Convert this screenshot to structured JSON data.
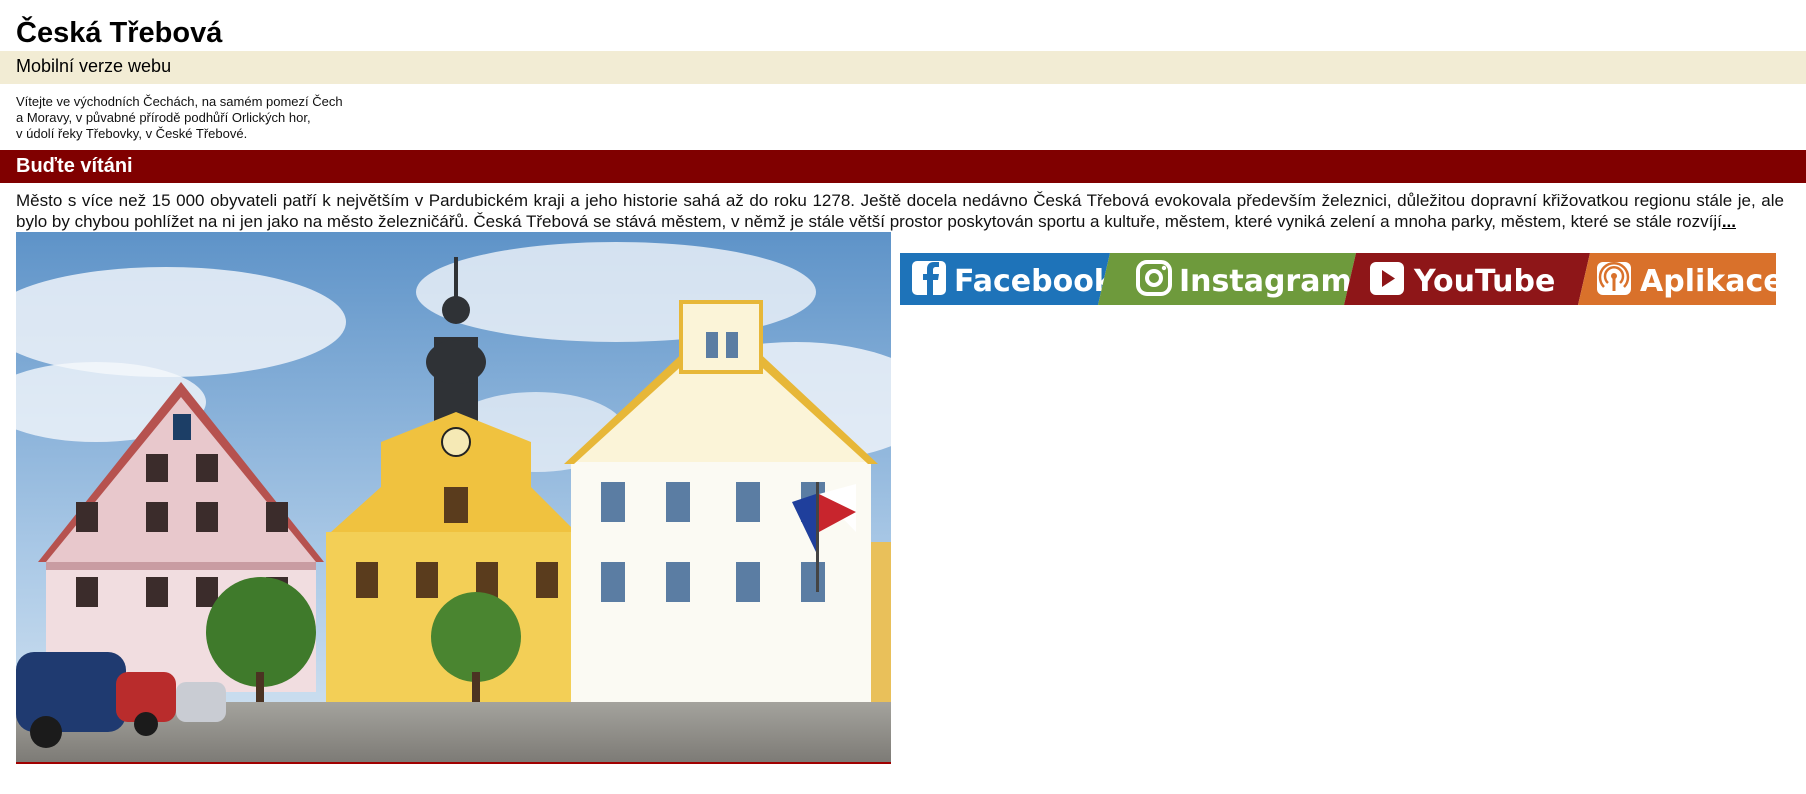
{
  "site": {
    "title": "Česká Třebová",
    "subtitle": "Mobilní verze webu"
  },
  "intro": {
    "line1": "Vítejte ve východních Čechách, na samém pomezí Čech",
    "line2": "a Moravy, v půvabné přírodě podhůří Orlických hor,",
    "line3": "v údolí řeky Třebovky, v České Třebové."
  },
  "welcome": {
    "heading": "Buďte vítáni",
    "text": "Město s více než 15 000 obyvateli patří k největším v Pardubickém kraji a jeho historie sahá až do roku 1278. Ještě docela nedávno Česká Třebová evokovala především železnici, důležitou dopravní křižovatkou regionu stále je, ale bylo by chybou pohlížet na ni jen jako na město železničářů. Česká Třebová se  stává městem, v němž je  stále větší prostor poskytován sportu a kultuře, městem, které vyniká zelení a mnoha parky, městem, které se stále rozvíjí",
    "more_label": "..."
  },
  "social": {
    "facebook": "Facebook",
    "instagram": "Instagram",
    "youtube": "YouTube",
    "app": "Aplikace",
    "icons": [
      "facebook-icon",
      "instagram-icon",
      "youtube-icon",
      "podcast-icon"
    ],
    "colors": {
      "facebook": "#1e73b9",
      "instagram": "#6e9a3c",
      "youtube": "#8e1618",
      "app": "#d9712b"
    }
  },
  "colors": {
    "subtitle_bar": "#f2ecd4",
    "section_heading": "#800000"
  }
}
